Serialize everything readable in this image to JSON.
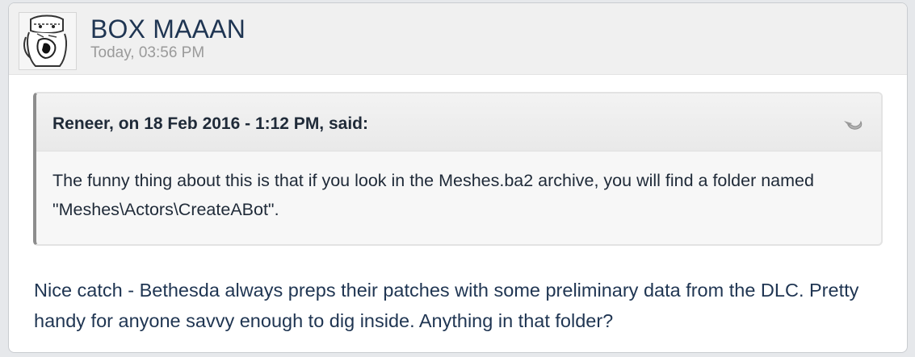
{
  "post": {
    "author": "BOX MAAAN",
    "timestamp": "Today, 03:56 PM",
    "quote": {
      "citation": "Reneer, on 18 Feb 2016 - 1:12 PM, said:",
      "text": "The funny thing about this is that if you look in the Meshes.ba2 archive, you will find a folder named \"Meshes\\Actors\\CreateABot\".",
      "jump_icon": "snapback-arrow-icon"
    },
    "body": "Nice catch - Bethesda always preps their patches with some preliminary data from the DLC. Pretty handy for anyone savvy enough to dig inside. Anything in that folder?"
  },
  "colors": {
    "author": "#1f3552",
    "timestamp": "#9a9a9a",
    "quote_border": "#8d8d8d",
    "header_bg": "#f0f0f0"
  }
}
